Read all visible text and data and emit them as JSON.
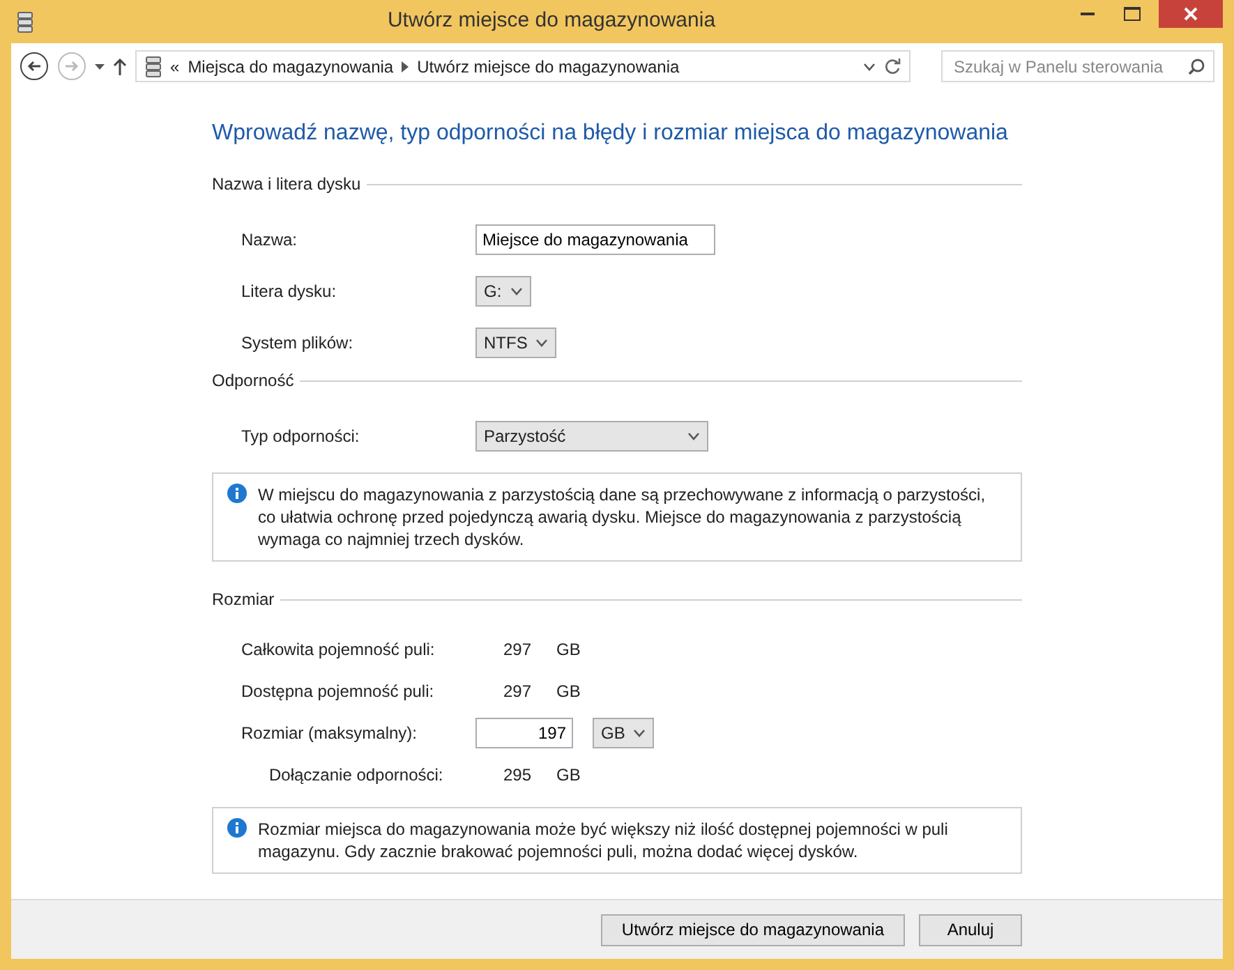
{
  "window": {
    "title": "Utwórz miejsce do magazynowania"
  },
  "nav": {
    "back_disabled": false,
    "forward_disabled": true,
    "breadcrumb_prefix": "«",
    "breadcrumb": [
      "Miejsca do magazynowania",
      "Utwórz miejsce do magazynowania"
    ],
    "search": {
      "placeholder": "Szukaj w Panelu sterowania"
    }
  },
  "heading": "Wprowadź nazwę, typ odporności na błędy i rozmiar miejsca do magazynowania",
  "sections": [
    {
      "title": "Nazwa i litera dysku",
      "rows": [
        {
          "kind": "text",
          "label": "Nazwa:",
          "value": "Miejsce do magazynowania"
        },
        {
          "kind": "select",
          "label": "Litera dysku:",
          "value": "G:"
        },
        {
          "kind": "select",
          "label": "System plików:",
          "value": "NTFS"
        }
      ]
    },
    {
      "title": "Odporność",
      "rows": [
        {
          "kind": "wideselect",
          "label": "Typ odporności:",
          "value": "Parzystość"
        }
      ],
      "note": "W miejscu do magazynowania z parzystością dane są przechowywane z informacją o parzystości, co ułatwia ochronę przed pojedynczą awarią dysku. Miejsce do magazynowania z parzystością wymaga co najmniej trzech dysków."
    },
    {
      "title": "Rozmiar",
      "rows": [
        {
          "kind": "reading",
          "label": "Całkowita pojemność puli:",
          "value": "297",
          "unit": "GB"
        },
        {
          "kind": "reading",
          "label": "Dostępna pojemność puli:",
          "value": "297",
          "unit": "GB"
        },
        {
          "kind": "size",
          "label": "Rozmiar (maksymalny):",
          "value": "197",
          "unit": "GB"
        },
        {
          "kind": "subreading",
          "label": "Dołączanie odporności:",
          "value": "295",
          "unit": "GB"
        }
      ],
      "note": "Rozmiar miejsca do magazynowania może być większy niż ilość dostępnej pojemności w puli magazynu. Gdy zacznie brakować pojemności puli, można dodać więcej dysków."
    }
  ],
  "buttons": [
    "Utwórz miejsce do magazynowania",
    "Anuluj"
  ]
}
